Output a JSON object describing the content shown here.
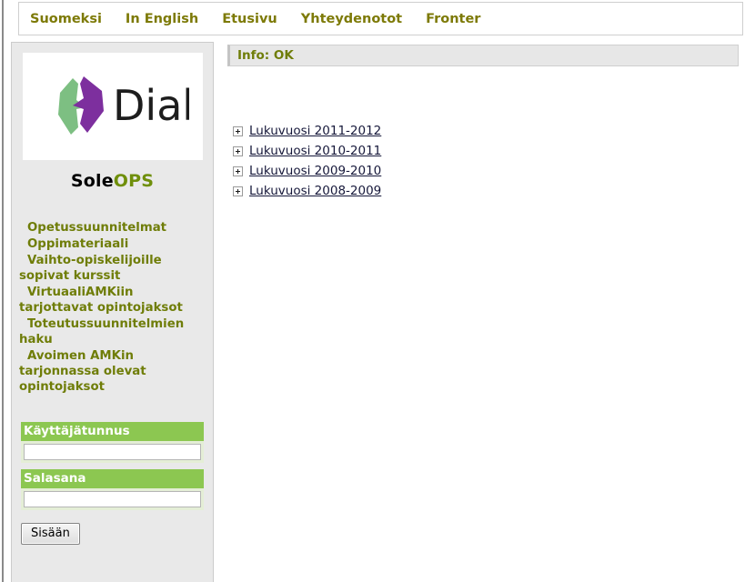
{
  "topnav": {
    "items": [
      {
        "label": "Suomeksi",
        "name": "nav-suomeksi"
      },
      {
        "label": "In English",
        "name": "nav-in-english"
      },
      {
        "label": "Etusivu",
        "name": "nav-etusivu"
      },
      {
        "label": "Yhteydenotot",
        "name": "nav-yhteydenotot"
      },
      {
        "label": "Fronter",
        "name": "nav-fronter"
      }
    ]
  },
  "sidebar": {
    "logo": {
      "icon": "diak-leaf-logo",
      "wordmark": "Diak",
      "green": "#7dbf82",
      "purple": "#7d2f9e"
    },
    "brand": {
      "first": "Sole",
      "second": "OPS"
    },
    "links": [
      "Opetussuunnitelmat",
      "Oppimateriaali",
      "Vaihto-opiskelijoille sopivat kurssit",
      "VirtuaaliAMKiin tarjottavat opintojaksot",
      "Toteutussuunnitelmien haku",
      "Avoimen AMKin tarjonnassa olevat opintojaksot"
    ],
    "login": {
      "username_label": "Käyttäjätunnus",
      "username_value": "",
      "password_label": "Salasana",
      "password_value": "",
      "submit_label": "Sisään"
    }
  },
  "main": {
    "info": "Info: OK",
    "tree": [
      {
        "expand_icon": "plus-box-icon",
        "label": "Lukuvuosi 2011-2012"
      },
      {
        "expand_icon": "plus-box-icon",
        "label": "Lukuvuosi 2010-2011"
      },
      {
        "expand_icon": "plus-box-icon",
        "label": "Lukuvuosi 2009-2010"
      },
      {
        "expand_icon": "plus-box-icon",
        "label": "Lukuvuosi 2008-2009"
      }
    ]
  },
  "colors": {
    "nav_link": "#7d7a07",
    "side_link": "#6f7d08",
    "accent_green": "#8cc751",
    "tree_link": "#16183a"
  }
}
